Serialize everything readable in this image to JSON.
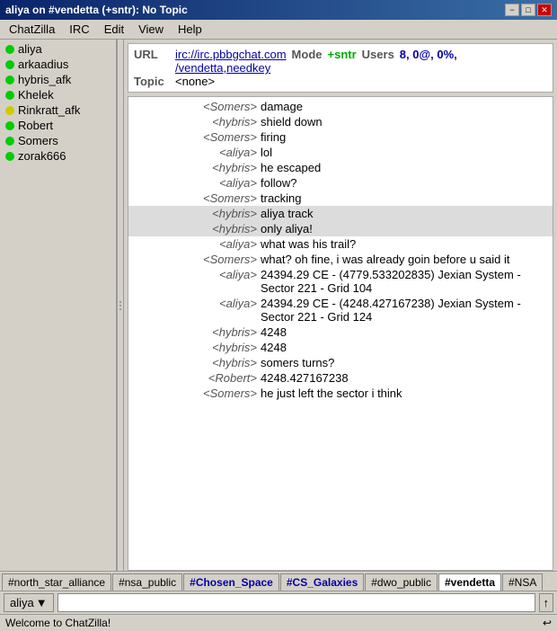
{
  "titleBar": {
    "title": "aliya on #vendetta (+sntr): No Topic",
    "minimizeLabel": "−",
    "maximizeLabel": "□",
    "closeLabel": "✕"
  },
  "menuBar": {
    "items": [
      "ChatZilla",
      "IRC",
      "Edit",
      "View",
      "Help"
    ]
  },
  "sidebar": {
    "users": [
      {
        "name": "aliya",
        "status": "green"
      },
      {
        "name": "arkaadius",
        "status": "green"
      },
      {
        "name": "hybris_afk",
        "status": "green"
      },
      {
        "name": "Khelek",
        "status": "green"
      },
      {
        "name": "Rinkratt_afk",
        "status": "yellow"
      },
      {
        "name": "Robert",
        "status": "green"
      },
      {
        "name": "Somers",
        "status": "green"
      },
      {
        "name": "zorak666",
        "status": "green"
      }
    ]
  },
  "infoBox": {
    "urlLabel": "URL",
    "url1": "irc://irc.pbbgchat.com",
    "modeLabel": "Mode",
    "mode": "+sntr",
    "usersLabel": "Users",
    "users": "8, 0@, 0%,",
    "url2": "/vendetta,needkey",
    "topicLabel": "Topic",
    "topic": "<none>"
  },
  "messages": [
    {
      "nick": "<Somers>",
      "content": "damage",
      "highlight": false
    },
    {
      "nick": "<hybris>",
      "content": "shield down",
      "highlight": false
    },
    {
      "nick": "<Somers>",
      "content": "firing",
      "highlight": false
    },
    {
      "nick": "<aliya>",
      "content": "lol",
      "highlight": false
    },
    {
      "nick": "<hybris>",
      "content": "he escaped",
      "highlight": false
    },
    {
      "nick": "<aliya>",
      "content": "follow?",
      "highlight": false
    },
    {
      "nick": "<Somers>",
      "content": "tracking",
      "highlight": false
    },
    {
      "nick": "<hybris>",
      "content": "aliya track",
      "highlight": true
    },
    {
      "nick": "<hybris>",
      "content": "only aliya!",
      "highlight": true
    },
    {
      "nick": "<aliya>",
      "content": "what was his trail?",
      "highlight": false
    },
    {
      "nick": "<Somers>",
      "content": "what? oh fine, i was already goin before u said it",
      "highlight": false
    },
    {
      "nick": "<aliya>",
      "content": "24394.29 CE          -  (4779.533202835)        Jexian System - Sector 221 - Grid 104",
      "highlight": false
    },
    {
      "nick": "<aliya>",
      "content": "24394.29 CE          -  (4248.427167238)        Jexian System - Sector 221 - Grid 124",
      "highlight": false
    },
    {
      "nick": "<hybris>",
      "content": "4248",
      "highlight": false
    },
    {
      "nick": "<hybris>",
      "content": "4248",
      "highlight": false
    },
    {
      "nick": "<hybris>",
      "content": "somers turns?",
      "highlight": false
    },
    {
      "nick": "<Robert>",
      "content": "4248.427167238",
      "highlight": false
    },
    {
      "nick": "<Somers>",
      "content": "he just left the sector i think",
      "highlight": false
    }
  ],
  "tabs": [
    {
      "label": "#north_star_alliance",
      "active": false,
      "colored": false
    },
    {
      "label": "#nsa_public",
      "active": false,
      "colored": false
    },
    {
      "label": "#Chosen_Space",
      "active": false,
      "colored": true
    },
    {
      "label": "#CS_Galaxies",
      "active": false,
      "colored": true
    },
    {
      "label": "#dwo_public",
      "active": false,
      "colored": false
    },
    {
      "label": "#vendetta",
      "active": true,
      "colored": false
    },
    {
      "label": "#NSA",
      "active": false,
      "colored": false
    }
  ],
  "inputArea": {
    "nick": "aliya",
    "placeholder": "",
    "sendArrow": "↑"
  },
  "statusBar": {
    "text": "Welcome to ChatZilla!",
    "icon": "↩"
  }
}
